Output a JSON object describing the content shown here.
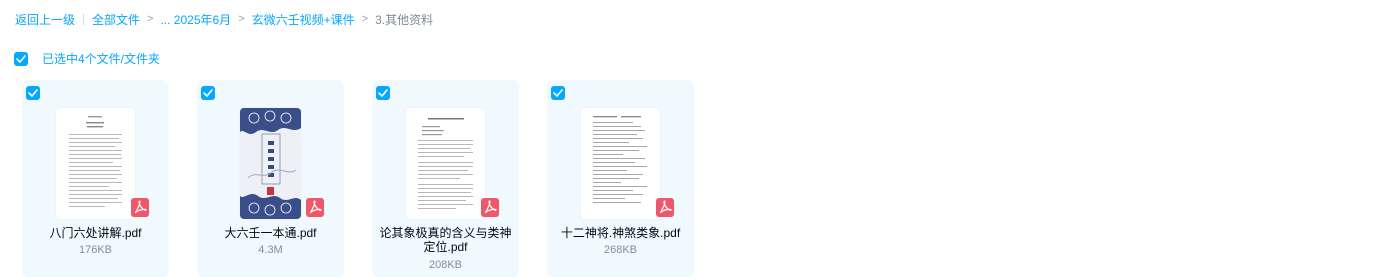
{
  "breadcrumb": {
    "back": "返回上一级",
    "all_files": "全部文件",
    "arrow": ">",
    "level1": "... 2025年6月",
    "level2": "玄微六壬视频+课件",
    "current": "3.其他资料"
  },
  "selection": {
    "text": "已选中4个文件/文件夹",
    "checked": true
  },
  "files": [
    {
      "name": "八门六处讲解.pdf",
      "size": "176KB",
      "checked": true,
      "icon": "pdf-icon"
    },
    {
      "name": "大六壬一本通.pdf",
      "size": "4.3M",
      "checked": true,
      "icon": "pdf-icon"
    },
    {
      "name": "论其象极真的含义与类神定位.pdf",
      "size": "208KB",
      "checked": true,
      "icon": "pdf-icon"
    },
    {
      "name": "十二神将.神煞类象.pdf",
      "size": "268KB",
      "checked": true,
      "icon": "pdf-icon"
    }
  ],
  "colors": {
    "accent": "#06a7ff",
    "card_bg": "#f0f9fe",
    "pdf_red": "#f0576a"
  }
}
